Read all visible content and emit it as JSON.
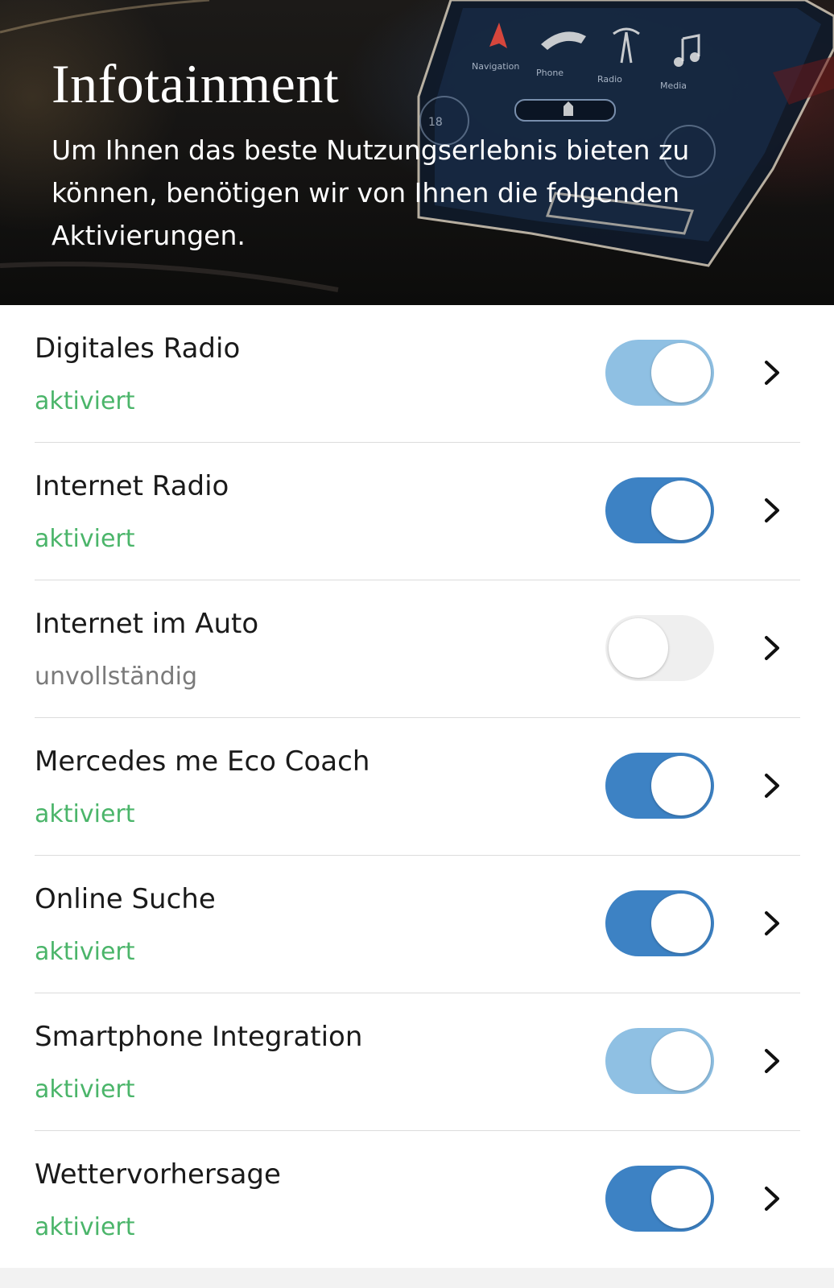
{
  "header": {
    "title": "Infotainment",
    "subtitle": "Um Ihnen das beste Nutzungserlebnis bieten zu können, benötigen wir von Ihnen die folgenden Aktivierungen.",
    "screen_labels": [
      "Navigation",
      "Phone",
      "Radio",
      "Media"
    ],
    "temperature": "18"
  },
  "colors": {
    "status_active": "#4bb56a",
    "status_incomplete": "#7a7a7a",
    "toggle_on": "#3d82c4",
    "toggle_on_light": "#8fc0e3",
    "toggle_off": "#efefef"
  },
  "settings": {
    "items": [
      {
        "label": "Digitales Radio",
        "status": "aktiviert",
        "state": "active",
        "toggle": "on-light"
      },
      {
        "label": "Internet Radio",
        "status": "aktiviert",
        "state": "active",
        "toggle": "on"
      },
      {
        "label": "Internet im Auto",
        "status": "unvollständig",
        "state": "incomplete",
        "toggle": "off"
      },
      {
        "label": "Mercedes me Eco Coach",
        "status": "aktiviert",
        "state": "active",
        "toggle": "on"
      },
      {
        "label": "Online Suche",
        "status": "aktiviert",
        "state": "active",
        "toggle": "on"
      },
      {
        "label": "Smartphone Integration",
        "status": "aktiviert",
        "state": "active",
        "toggle": "on-light"
      },
      {
        "label": "Wettervorhersage",
        "status": "aktiviert",
        "state": "active",
        "toggle": "on"
      }
    ],
    "icon_names": {
      "toggle": "toggle-switch",
      "detail": "chevron-right-icon"
    }
  }
}
